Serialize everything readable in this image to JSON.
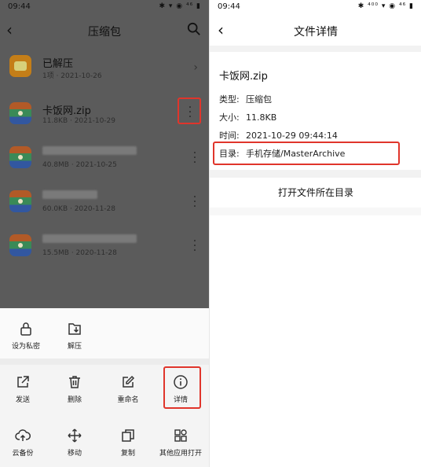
{
  "left": {
    "status": {
      "time": "09:44",
      "icons": "✱ ▾ ◉ ⁴⁶ ▮"
    },
    "header": {
      "title": "压缩包"
    },
    "items": [
      {
        "name": "已解压",
        "meta": "1项 · 2021-10-26",
        "icon": "folder-icon"
      },
      {
        "name": "卡饭网.zip",
        "meta": "11.8KB · 2021-10-29",
        "icon": "zip-icon"
      },
      {
        "name": "",
        "meta": "40.8MB · 2021-10-25",
        "icon": "zip-icon"
      },
      {
        "name": "",
        "meta": "60.0KB · 2020-11-28",
        "icon": "zip-icon"
      },
      {
        "name": "",
        "meta": "15.5MB · 2020-11-28",
        "icon": "zip-icon"
      }
    ],
    "sheet": {
      "set_private": "设为私密",
      "extract": "解压",
      "send": "发送",
      "delete": "删除",
      "rename": "重命名",
      "details": "详情",
      "cloud_backup": "云备份",
      "move": "移动",
      "copy": "复制",
      "open_with": "其他应用打开"
    }
  },
  "right": {
    "status": {
      "time": "09:44",
      "icons": "✱ ⁴⁰⁰ ▾ ◉ ⁴⁶ ▮"
    },
    "header": {
      "title": "文件详情"
    },
    "file_name": "卡饭网.zip",
    "type_label": "类型:",
    "type_value": "压缩包",
    "size_label": "大小:",
    "size_value": "11.8KB",
    "time_label": "时间:",
    "time_value": "2021-10-29 09:44:14",
    "dir_label": "目录:",
    "dir_value": "手机存储/MasterArchive",
    "open_dir_button": "打开文件所在目录"
  },
  "colors": {
    "highlight": "#e0352b",
    "dim_overlay": "#5b5b5b"
  }
}
